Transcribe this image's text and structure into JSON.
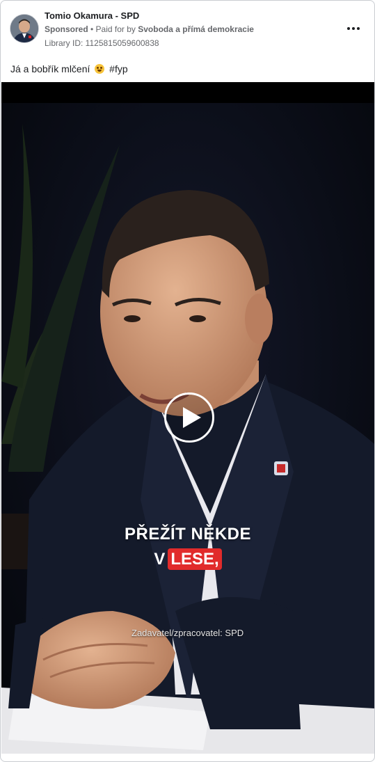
{
  "ad": {
    "page_name": "Tomio Okamura - SPD",
    "sponsored_label": "Sponsored",
    "separator": " • ",
    "paid_for_prefix": "Paid for by ",
    "paid_for_by": "Svoboda a přímá demokracie",
    "library_id": "Library ID: 1125815059600838",
    "caption_text": "Já a bobřík mlčení",
    "caption_emoji": "grinning-sweat-emoji",
    "caption_hashtag": "#fyp"
  },
  "video": {
    "subtitle_line1": "PŘEŽÍT NĚKDE",
    "subtitle_line2_plain": "V",
    "subtitle_line2_highlight": "LESE,",
    "watermark": "Zadavatel/zpracovatel: SPD",
    "highlight_color": "#e12b2b"
  },
  "icons": {
    "more": "more-options-icon",
    "play": "play-icon"
  }
}
